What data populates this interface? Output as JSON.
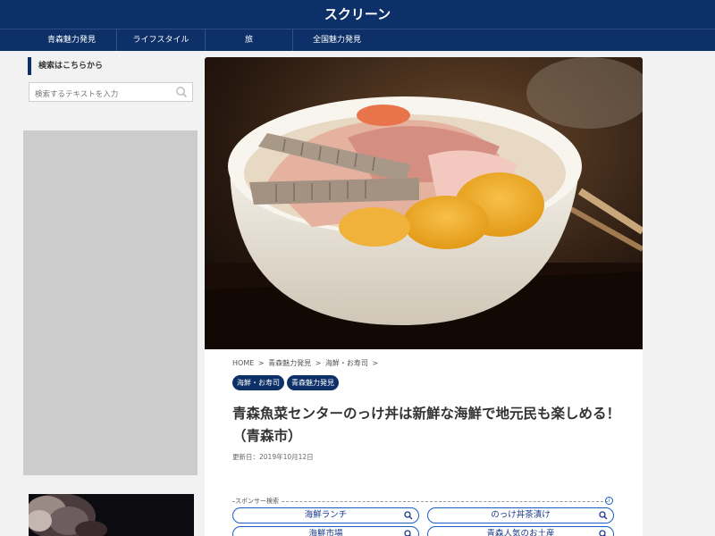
{
  "site": {
    "title": "スクリーン"
  },
  "nav": {
    "items": [
      {
        "label": "青森魅力発見"
      },
      {
        "label": "ライフスタイル"
      },
      {
        "label": "旅"
      },
      {
        "label": "全国魅力発見"
      }
    ]
  },
  "sidebar": {
    "search_heading": "検索はこちらから",
    "search_placeholder": "検索するテキストを入力",
    "search_icon": "magnifier-icon"
  },
  "article": {
    "breadcrumb": [
      "HOME",
      ">",
      "青森魅力発見",
      ">",
      "海鮮・お寿司",
      ">"
    ],
    "tags": [
      "海鮮・お寿司",
      "青森魅力発見"
    ],
    "title": "青森魚菜センターのっけ丼は新鮮な海鮮で地元民も楽しめる！（青森市）",
    "updated": "更新日：2019年10月12日"
  },
  "sponsor": {
    "label": "スポンサー検索",
    "links": [
      "海鮮ランチ",
      "のっけ丼茶漬け",
      "海鮮市場",
      "青森人気のお土産"
    ]
  },
  "colors": {
    "brand": "#0d3068",
    "link": "#1a5ec4",
    "ad_gray": "#cccccc"
  }
}
